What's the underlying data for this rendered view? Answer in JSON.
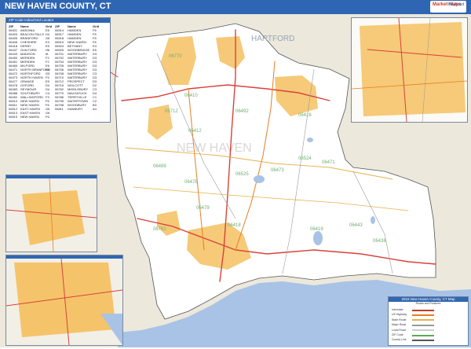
{
  "title": "NEW HAVEN COUNTY, CT",
  "logo": {
    "brand": "Market Maps",
    "tag": "Inkyhood"
  },
  "map_labels": {
    "hartford": "HARTFORD",
    "county": "NEW HAVEN",
    "zips": [
      "06410",
      "06416",
      "06489",
      "06479",
      "06712",
      "06762",
      "06770",
      "06478",
      "06492",
      "06473",
      "06471",
      "06443",
      "06418",
      "06525",
      "06524",
      "06419",
      "06412",
      "06438"
    ]
  },
  "legend": {
    "header": "ZIP Code Index/Grid Locator",
    "col_headers": [
      "ZIP",
      "Name",
      "Grid",
      "ZIP",
      "Name",
      "Grid"
    ],
    "rows": [
      [
        "06401",
        "ANSONIA",
        "E5",
        "06514",
        "HAMDEN",
        "F6"
      ],
      [
        "06403",
        "BEACON FALLS",
        "D4",
        "06517",
        "HAMDEN",
        "F5"
      ],
      [
        "06405",
        "BRANFORD",
        "G6",
        "06518",
        "HAMDEN",
        "F5"
      ],
      [
        "06408",
        "CHESHIRE",
        "E3",
        "06519",
        "NEW HAVEN",
        "F6"
      ],
      [
        "06418",
        "DERBY",
        "E5",
        "06524",
        "BETHANY",
        "E4"
      ],
      [
        "06437",
        "GUILFORD",
        "H6",
        "06525",
        "WOODBRIDGE",
        "E5"
      ],
      [
        "06443",
        "MADISON",
        "I6",
        "06701",
        "WATERBURY",
        "D3"
      ],
      [
        "06450",
        "MERIDEN",
        "F2",
        "06702",
        "WATERBURY",
        "D3"
      ],
      [
        "06451",
        "MERIDEN",
        "F2",
        "06704",
        "WATERBURY",
        "D3"
      ],
      [
        "06460",
        "MILFORD",
        "E6",
        "06705",
        "WATERBURY",
        "D3"
      ],
      [
        "06471",
        "NORTH BRANFORD",
        "G5",
        "06706",
        "WATERBURY",
        "D3"
      ],
      [
        "06472",
        "NORTHFORD",
        "G5",
        "06708",
        "WATERBURY",
        "C3"
      ],
      [
        "06473",
        "NORTH HAVEN",
        "F5",
        "06710",
        "WATERBURY",
        "D3"
      ],
      [
        "06477",
        "ORANGE",
        "E5",
        "06712",
        "PROSPECT",
        "D3"
      ],
      [
        "06478",
        "OXFORD",
        "D4",
        "06716",
        "WOLCOTT",
        "D2"
      ],
      [
        "06483",
        "SEYMOUR",
        "D4",
        "06762",
        "MIDDLEBURY",
        "C3"
      ],
      [
        "06488",
        "SOUTHBURY",
        "C4",
        "06770",
        "NAUGATUCK",
        "D4"
      ],
      [
        "06492",
        "WALLINGFORD",
        "F3",
        "06786",
        "TERRYVILLE",
        "C1"
      ],
      [
        "06510",
        "NEW HAVEN",
        "F6",
        "06795",
        "WATERTOWN",
        "C2"
      ],
      [
        "06511",
        "NEW HAVEN",
        "F6",
        "06798",
        "WOODBURY",
        "B3"
      ],
      [
        "06512",
        "EAST HAVEN",
        "G6",
        "06811",
        "DANBURY",
        "A4"
      ],
      [
        "06513",
        "EAST HAVEN",
        "G6",
        "",
        "",
        ""
      ],
      [
        "06515",
        "NEW HAVEN",
        "F6",
        "",
        "",
        ""
      ]
    ]
  },
  "key": {
    "title": "2016 New Haven County, CT Map",
    "subtitle": "Roads and Features",
    "items": [
      {
        "label": "Interstate",
        "color": "#c0392b"
      },
      {
        "label": "US Highway",
        "color": "#e67e22"
      },
      {
        "label": "State Route",
        "color": "#e8b04a"
      },
      {
        "label": "Major Road",
        "color": "#999999"
      },
      {
        "label": "Local Road",
        "color": "#cccccc"
      },
      {
        "label": "ZIP Code",
        "color": "#5aa95a"
      },
      {
        "label": "County Line",
        "color": "#555555"
      }
    ]
  },
  "colors": {
    "water": "#a9c3e6",
    "county": "#ffffff",
    "outside": "#ece8dc",
    "urban": "#f5c46a",
    "highway": "#d9413a",
    "header": "#2f66b3"
  }
}
